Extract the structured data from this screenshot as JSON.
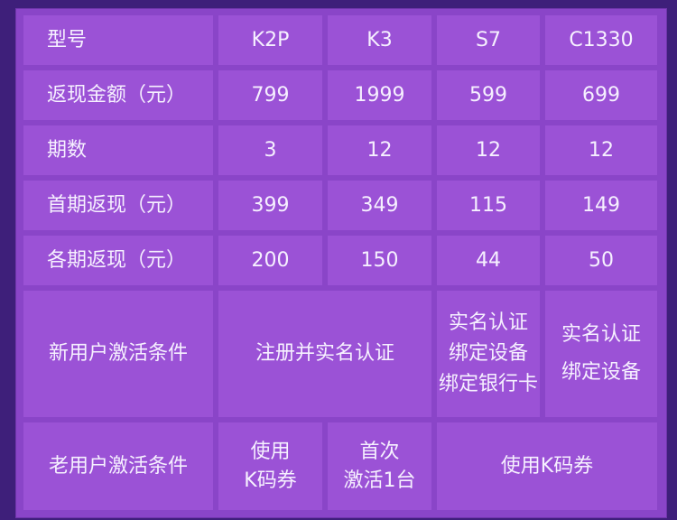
{
  "table": {
    "header": {
      "label": "型号",
      "models": [
        "K2P",
        "K3",
        "S7",
        "C1330"
      ]
    },
    "rows": [
      {
        "label": "返现金额（元）",
        "values": [
          "799",
          "1999",
          "599",
          "699"
        ]
      },
      {
        "label": "期数",
        "values": [
          "3",
          "12",
          "12",
          "12"
        ]
      },
      {
        "label": "首期返现（元）",
        "values": [
          "399",
          "349",
          "115",
          "149"
        ]
      },
      {
        "label": "各期返现（元）",
        "values": [
          "200",
          "150",
          "44",
          "50"
        ]
      }
    ],
    "new_user": {
      "label": "新用户激活条件",
      "k2p_k3": "注册并实名认证",
      "s7": [
        "实名认证",
        "绑定设备",
        "绑定银行卡"
      ],
      "c1330": [
        "实名认证",
        "绑定设备"
      ]
    },
    "old_user": {
      "label": "老用户激活条件",
      "k2p": [
        "使用",
        "K码券"
      ],
      "k3": [
        "首次",
        "激活1台"
      ],
      "s7_c1330": "使用K码券"
    }
  }
}
